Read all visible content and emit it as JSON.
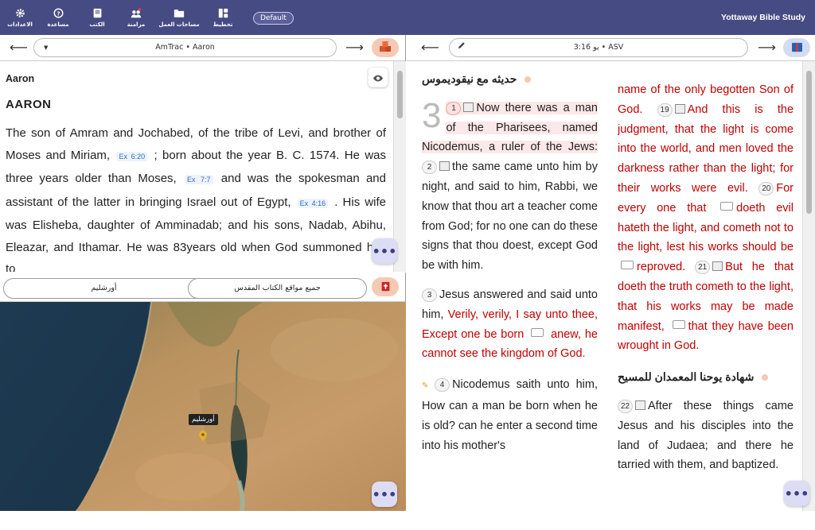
{
  "toolbar": {
    "items": [
      {
        "label": "الاعدادات",
        "icon": "gear-icon"
      },
      {
        "label": "مساعدة",
        "icon": "help-icon"
      },
      {
        "label": "الكتب",
        "icon": "books-icon"
      },
      {
        "label": "مزامنة",
        "icon": "sync-icon"
      },
      {
        "label": "مساحات العمل",
        "icon": "folder-icon"
      },
      {
        "label": "تخطيط",
        "icon": "layout-icon"
      }
    ],
    "workspace_pill": "Default",
    "app_title": "Yottaway Bible Study"
  },
  "left_top": {
    "ref_label": "AmTrac • Aaron",
    "small_title": "Aaron",
    "big_title": "AARON",
    "p1": "The son of Amram and Jochabed, of the tribe of Levi, and brother of Moses and Miriam,",
    "x1": "Ex 6:20",
    "p2": "; born about the year B. C. 1574. He was three years older than Moses,",
    "x2": "Ex 7:7",
    "p3": "and was the spokesman and assistant of the latter in bringing Israel out of Egypt,",
    "x3": "Ex 4:16",
    "p4": ". His wife was Elisheba, daughter of Amminadab; and his sons, Nadab, Abihu, Eleazar, and Ithamar. He was 83years old when God summoned him to"
  },
  "map": {
    "place_field": "أورشليم",
    "all_places_field": "جميع مواقع الكتاب المقدس",
    "marker_label": "أورشليم"
  },
  "right": {
    "ref_label": "يو 3:16 • ASV",
    "heading1": "حديثه مع نيقوديموس",
    "chapter": "3",
    "v1num": "1",
    "v1": "Now there was a man of the Pharisees, named Nicodemus, a ruler of the Jews:",
    "v2num": "2",
    "v2": "the same came unto him by night, and said to him, Rabbi, we know that thou art a teacher come from God; for no one can do these signs that thou doest, except God be with him.",
    "v3num": "3",
    "v3a": "Jesus answered and said unto him,",
    "v3b": "Verily, verily, I say unto thee, Except one be born",
    "v3c": "anew, he cannot see the kingdom of God.",
    "v4num": "4",
    "v4": "Nicodemus saith unto him, How can a man be born when he is old? can he enter a second time into his mother's",
    "c2a": "name of the only begotten Son of God.",
    "v19num": "19",
    "v19": "And this is the judgment, that the light is come into the world, and men loved the darkness rather than the light; for their works were evil.",
    "v20num": "20",
    "v20a": "For every one that",
    "v20b": "doeth evil hateth the light, and cometh not to the light, lest his works should be",
    "v20c": "reproved.",
    "v21num": "21",
    "v21a": "But he that doeth the truth cometh to the light, that his works may be made manifest,",
    "v21b": "that they have been wrought in God.",
    "heading2": "شهادة يوحنا المعمدان للمسيح",
    "v22num": "22",
    "v22": "After these things came Jesus and his disciples into the land of Judaea; and there he tarried with them, and baptized."
  },
  "colors": {
    "topbar": "#474b84",
    "red_letter": "#c00000",
    "accent_button": "#f6c9b5"
  }
}
